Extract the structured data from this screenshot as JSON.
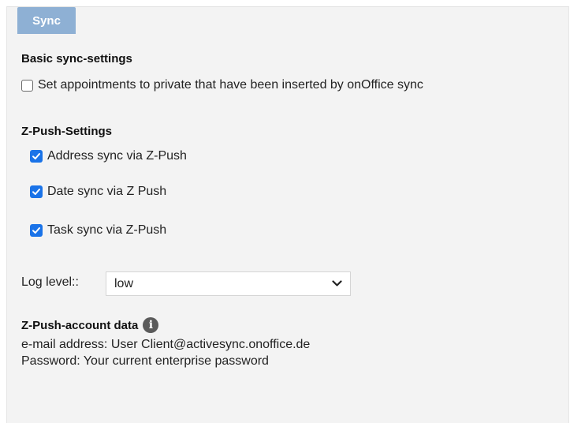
{
  "tab": {
    "label": "Sync"
  },
  "basic": {
    "heading": "Basic sync-settings",
    "private_label": "Set appointments to private that have been inserted by onOffice sync",
    "private_checked": false
  },
  "zpush": {
    "heading": "Z-Push-Settings",
    "options": [
      {
        "label": "Address sync via Z-Push",
        "checked": true
      },
      {
        "label": "Date sync via Z Push",
        "checked": true
      },
      {
        "label": "Task sync via Z-Push",
        "checked": true
      }
    ]
  },
  "log": {
    "label": "Log level::",
    "value": "low"
  },
  "account": {
    "heading": "Z-Push-account data",
    "email_line": "e-mail address: User  Client@activesync.onoffice.de",
    "password_line": "Password: Your current enterprise password"
  },
  "colors": {
    "tab": "#8eb0d4",
    "checkbox": "#1a73e8",
    "panel": "#f3f3f3"
  }
}
